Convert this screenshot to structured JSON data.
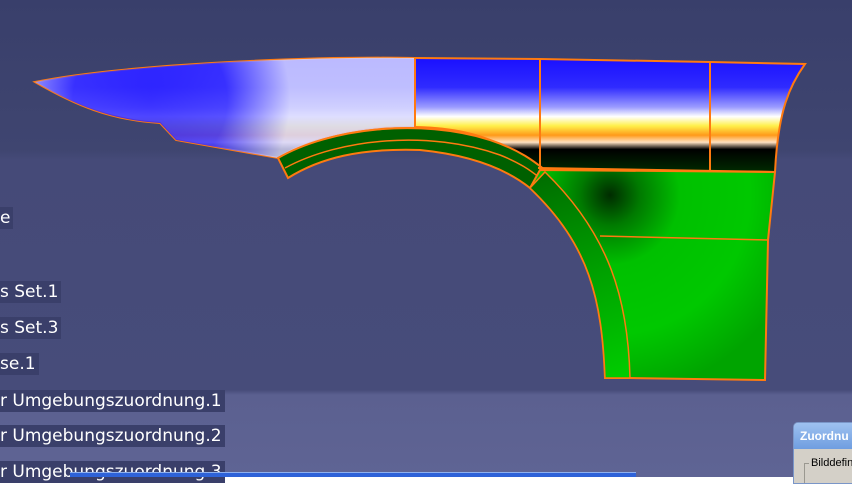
{
  "tree": {
    "items": [
      {
        "label": "e"
      },
      {
        "label": "s Set.1"
      },
      {
        "label": "s Set.3"
      },
      {
        "label": "se.1"
      },
      {
        "label": "r Umgebungszuordnung.1"
      },
      {
        "label": "r Umgebungszuordnung.2"
      },
      {
        "label": "r Umgebungszuordnung.3"
      }
    ]
  },
  "dialog": {
    "title": "Zuordnu",
    "group_label": "Bilddefin"
  },
  "colors": {
    "edge": "#ff7a10",
    "upper_panel_base": "#1a10ff",
    "lower_panel_base": "#00c800",
    "highlight_band": "#ffd51a"
  }
}
